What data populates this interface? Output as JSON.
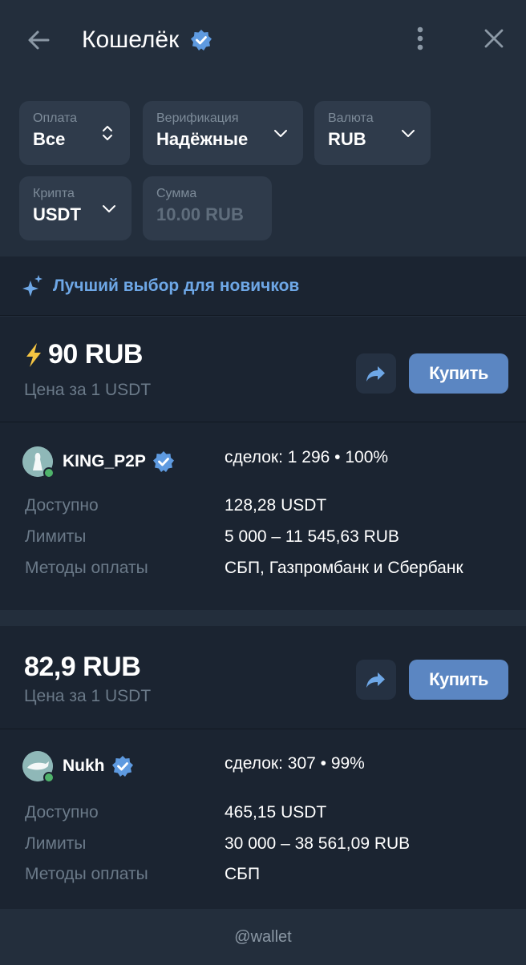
{
  "header": {
    "title": "Кошелёк",
    "back_icon": "arrow-left-icon",
    "verified_icon": "verified-badge-icon",
    "menu_icon": "more-vertical-icon",
    "close_icon": "close-icon"
  },
  "filters": [
    {
      "label": "Оплата",
      "value": "Все",
      "icon": "sort-updown-icon"
    },
    {
      "label": "Верификация",
      "value": "Надёжные",
      "icon": "chevron-down-icon"
    },
    {
      "label": "Валюта",
      "value": "RUB",
      "icon": "chevron-down-icon"
    },
    {
      "label": "Крипта",
      "value": "USDT",
      "icon": "chevron-down-icon"
    },
    {
      "label": "Сумма",
      "value": "10.00 RUB",
      "icon": ""
    }
  ],
  "banner": {
    "text": "Лучший выбор для новичков",
    "icon": "sparkles-icon"
  },
  "offers": [
    {
      "price": "90 RUB",
      "price_icon": "lightning-icon",
      "price_sub": "Цена за 1 USDT",
      "buy_label": "Купить",
      "seller": "KING_P2P",
      "deals": "сделок: 1 296 • 100%",
      "available_label": "Доступно",
      "available": "128,28 USDT",
      "limits_label": "Лимиты",
      "limits": "5 000 – 11 545,63 RUB",
      "methods_label": "Методы оплаты",
      "methods": "СБП, Газпромбанк и Сбербанк"
    },
    {
      "price": "82,9 RUB",
      "price_sub": "Цена за 1 USDT",
      "buy_label": "Купить",
      "seller": "Nukh",
      "deals": "сделок: 307 • 99%",
      "available_label": "Доступно",
      "available": "465,15 USDT",
      "limits_label": "Лимиты",
      "limits": "30 000 – 38 561,09 RUB",
      "methods_label": "Методы оплаты",
      "methods": "СБП"
    }
  ],
  "footer": {
    "text": "@wallet"
  },
  "colors": {
    "background": "#232e3c",
    "card": "#1b2431",
    "accent": "#5b86c2",
    "link": "#6ea7e6",
    "verified": "#5e9ae0",
    "lightning": "#f5c542",
    "online": "#4fb36b"
  }
}
